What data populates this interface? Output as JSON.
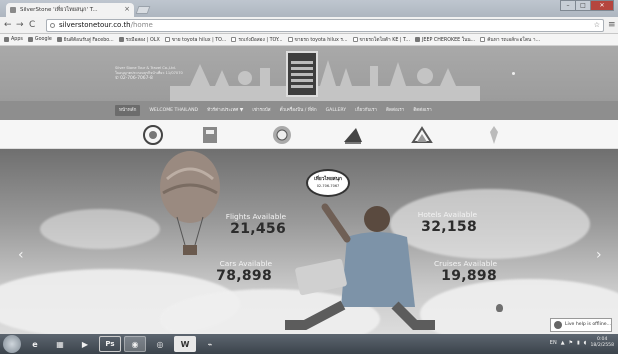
{
  "browser": {
    "tab_title": "SilverStone 'เที่ยวไทยสนุก' T...",
    "url_domain": "silverstonetour.co.th",
    "url_path": "/home",
    "bookmarks": [
      {
        "label": "Apps",
        "icon": "apps-icon"
      },
      {
        "label": "Google",
        "icon": "google-icon"
      },
      {
        "label": "ยินดีต้อนรับสู่ Facebo...",
        "icon": "facebook-icon"
      },
      {
        "label": "รถมือสอง | OLX",
        "icon": "olx-icon"
      },
      {
        "label": "ขาย toyota hilux | TO...",
        "icon": "page-icon"
      },
      {
        "label": "รถเก๋งมือสอง | TOY...",
        "icon": "page-icon"
      },
      {
        "label": "ขายรถ toyota hilux ร...",
        "icon": "page-icon"
      },
      {
        "label": "ขายรถโตโยต้า KE | T...",
        "icon": "page-icon"
      },
      {
        "label": "JEEP CHEROKEE ในน...",
        "icon": "jeep-icon"
      },
      {
        "label": "ค้นหา รถเอส์กะอโตน า...",
        "icon": "page-icon"
      }
    ]
  },
  "site": {
    "company_name": "Silver Stone Tour & Travel Co.,Ltd.",
    "license": "ใบอนุญาตประกอบธุรกิจนำเที่ยว 11/07070",
    "phone": "02-706-7067-8",
    "nav": [
      {
        "label": "หน้าหลัก",
        "active": true
      },
      {
        "label": "WELCOME THAILAND",
        "active": false
      },
      {
        "label": "ทัวร์ต่างประเทศ ▼",
        "active": false
      },
      {
        "label": "เช่ารถบัส",
        "active": false
      },
      {
        "label": "ตั๋วเครื่องบิน / ที่พัก",
        "active": false
      },
      {
        "label": "GALLERY",
        "active": false
      },
      {
        "label": "เกี่ยวกับเรา",
        "active": false
      },
      {
        "label": "ติดต่อเรา",
        "active": false
      },
      {
        "label": "ติดต่อเรา",
        "active": false
      }
    ],
    "partners": [
      "partner-seal-icon",
      "partner-building-icon",
      "partner-globe-icon",
      "partner-airline-icon",
      "partner-mountain-icon",
      "partner-emblem-icon"
    ]
  },
  "hero": {
    "bubble_title": "เที่ยวไทยสนุก",
    "bubble_phone": "02-706-7067",
    "stats": [
      {
        "label": "Flights Available",
        "value": "21,456"
      },
      {
        "label": "Cars Available",
        "value": "78,898"
      },
      {
        "label": "Hotels Available",
        "value": "32,158"
      },
      {
        "label": "Cruises Available",
        "value": "19,898"
      }
    ],
    "live_help": "Live help is offline..."
  },
  "taskbar": {
    "lang": "EN",
    "time": "0:04",
    "date": "18/2/2558",
    "apps": [
      "ie-icon",
      "explorer-icon",
      "media-icon",
      "photoshop-icon",
      "chrome-icon",
      "camera-icon",
      "word-icon",
      "acrobat-icon"
    ],
    "photoshop_label": "Ps",
    "word_label": "W"
  }
}
